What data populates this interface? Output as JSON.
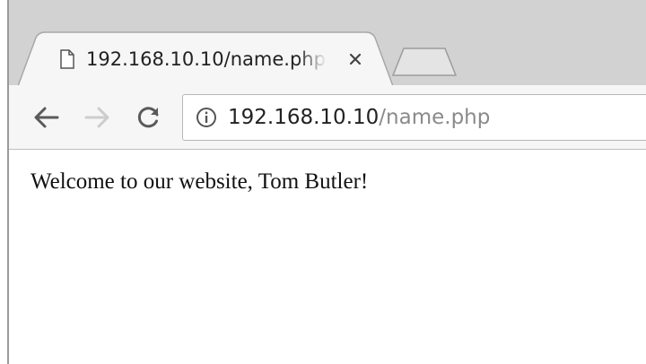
{
  "tab": {
    "title": "192.168.10.10/name.php",
    "favicon": "page-icon",
    "close_label": "×"
  },
  "toolbar": {
    "back_icon": "arrow-left-icon",
    "forward_icon": "arrow-right-icon",
    "reload_icon": "reload-icon"
  },
  "address_bar": {
    "info_icon": "info-icon",
    "host": "192.168.10.10",
    "path": "/name.php"
  },
  "page": {
    "text": "Welcome to our website, Tom Butler!"
  },
  "colors": {
    "tab_strip": "#d2d2d2",
    "active_tab": "#f6f6f6",
    "inactive_text": "#8a8a8a",
    "text": "#222222"
  }
}
